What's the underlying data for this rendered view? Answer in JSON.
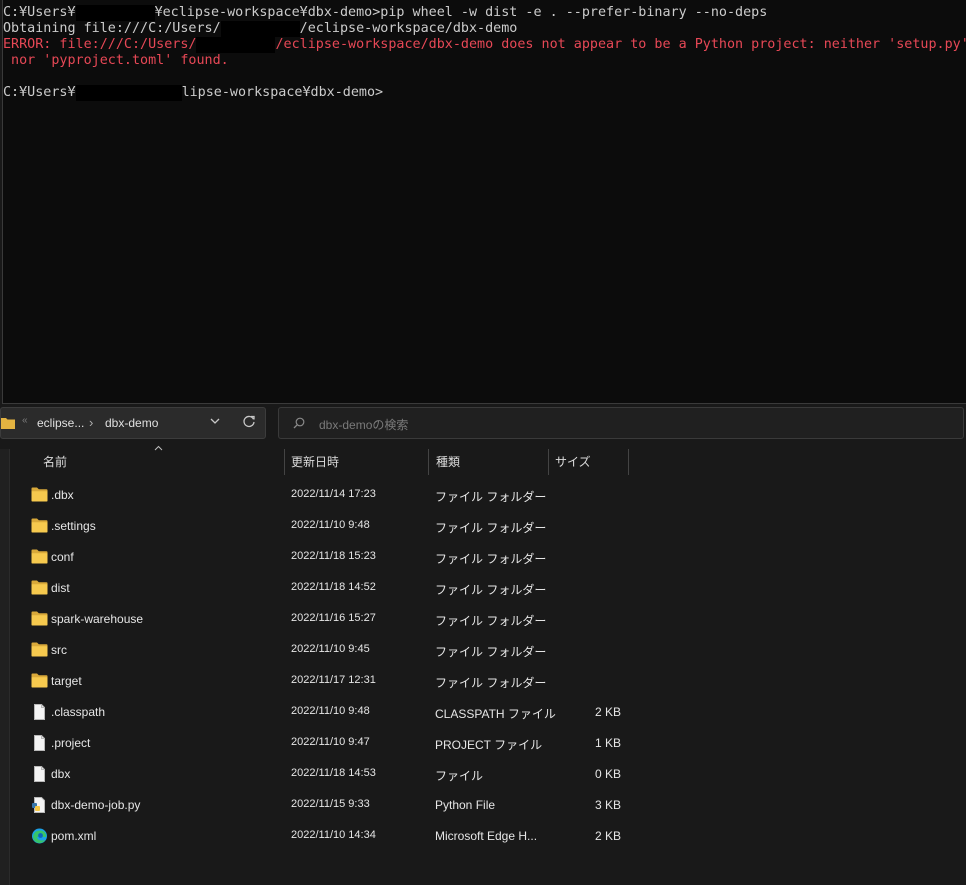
{
  "terminal": {
    "line1": {
      "pre": "C:¥Users¥",
      "post": "¥eclipse-workspace¥dbx-demo>pip wheel -w dist -e . --prefer-binary --no-deps"
    },
    "line2": {
      "pre": "Obtaining file:///C:/Users/",
      "post": "/eclipse-workspace/dbx-demo"
    },
    "line3": {
      "pre": "ERROR: file:///C:/Users/",
      "post": "/eclipse-workspace/dbx-demo does not appear to be a Python project: neither 'setup.py'"
    },
    "line4": " nor 'pyproject.toml' found.",
    "line6": {
      "pre": "C:¥Users¥",
      "post": "lipse-workspace¥dbx-demo>"
    },
    "colors": {
      "text": "#cccccc",
      "error": "#e74856",
      "background": "#0c0c0c"
    }
  },
  "explorer": {
    "breadcrumb": {
      "overflow": "«",
      "crumbs": [
        "eclipse...",
        "dbx-demo"
      ]
    },
    "search": {
      "placeholder": "dbx-demoの検索"
    },
    "columns": {
      "name": "名前",
      "date": "更新日時",
      "type": "種類",
      "size": "サイズ"
    },
    "files": [
      {
        "name": ".dbx",
        "date": "2022/11/14 17:23",
        "type": "ファイル フォルダー",
        "size": "",
        "icon": "folder-icon"
      },
      {
        "name": ".settings",
        "date": "2022/11/10 9:48",
        "type": "ファイル フォルダー",
        "size": "",
        "icon": "folder-icon"
      },
      {
        "name": "conf",
        "date": "2022/11/18 15:23",
        "type": "ファイル フォルダー",
        "size": "",
        "icon": "folder-icon"
      },
      {
        "name": "dist",
        "date": "2022/11/18 14:52",
        "type": "ファイル フォルダー",
        "size": "",
        "icon": "folder-icon"
      },
      {
        "name": "spark-warehouse",
        "date": "2022/11/16 15:27",
        "type": "ファイル フォルダー",
        "size": "",
        "icon": "folder-icon"
      },
      {
        "name": "src",
        "date": "2022/11/10 9:45",
        "type": "ファイル フォルダー",
        "size": "",
        "icon": "folder-icon"
      },
      {
        "name": "target",
        "date": "2022/11/17 12:31",
        "type": "ファイル フォルダー",
        "size": "",
        "icon": "folder-icon"
      },
      {
        "name": ".classpath",
        "date": "2022/11/10 9:48",
        "type": "CLASSPATH ファイル",
        "size": "2 KB",
        "icon": "file-icon"
      },
      {
        "name": ".project",
        "date": "2022/11/10 9:47",
        "type": "PROJECT ファイル",
        "size": "1 KB",
        "icon": "file-icon"
      },
      {
        "name": "dbx",
        "date": "2022/11/18 14:53",
        "type": "ファイル",
        "size": "0 KB",
        "icon": "file-icon"
      },
      {
        "name": "dbx-demo-job.py",
        "date": "2022/11/15 9:33",
        "type": "Python File",
        "size": "3 KB",
        "icon": "python-file-icon"
      },
      {
        "name": "pom.xml",
        "date": "2022/11/10 14:34",
        "type": "Microsoft Edge H...",
        "size": "2 KB",
        "icon": "edge-icon"
      }
    ]
  }
}
